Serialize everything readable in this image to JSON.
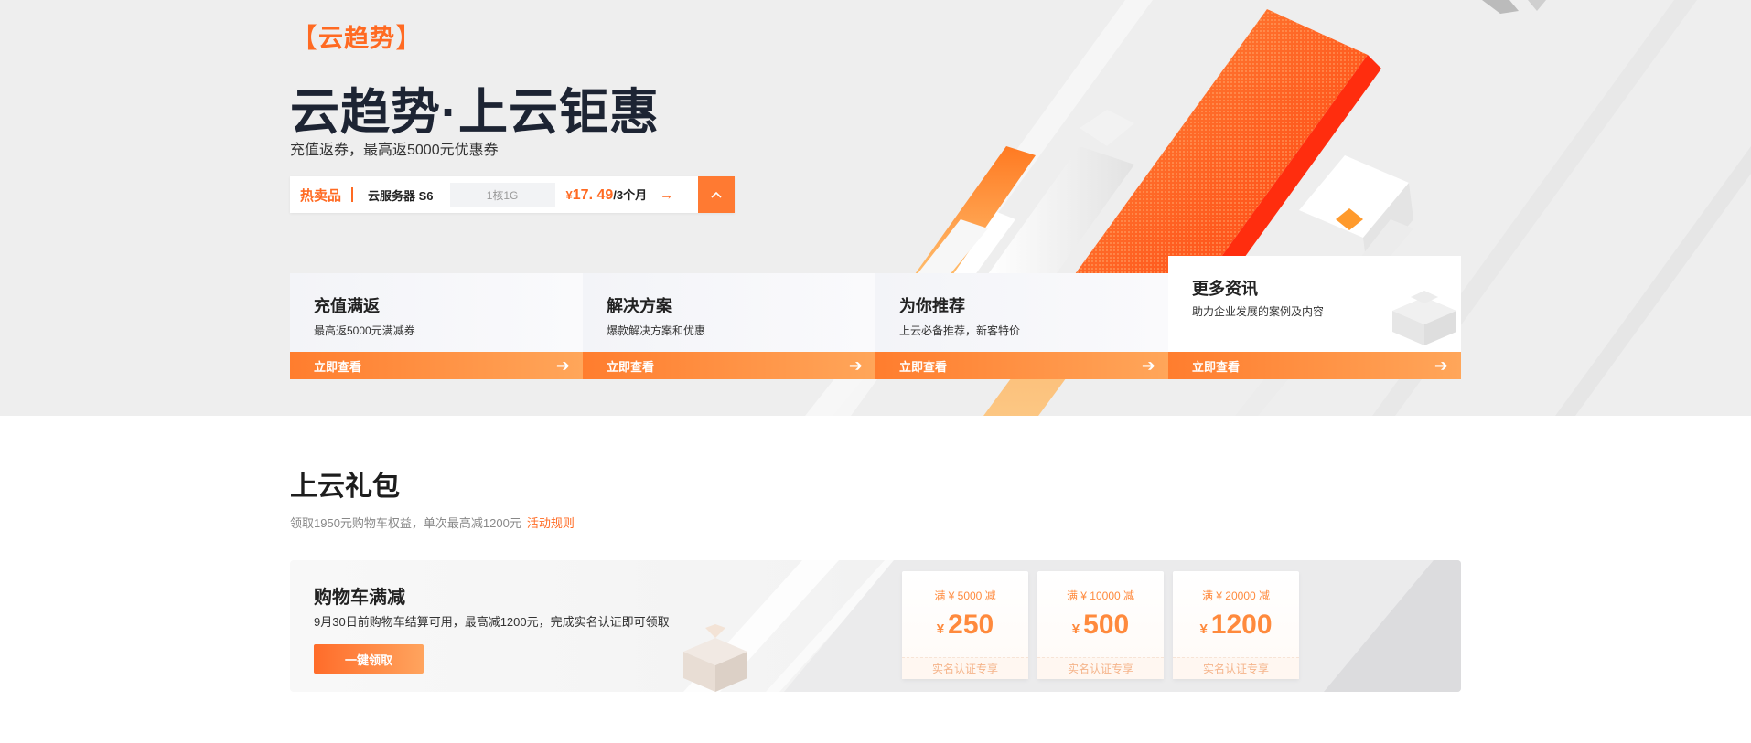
{
  "hero": {
    "brand_tag": "云趋势",
    "title": "云趋势·上云钜惠",
    "subtitle": "充值返券，最高返5000元优惠券",
    "hot": {
      "label": "热卖品",
      "product": "云服务器 S6",
      "spec": "1核1G",
      "price_symbol": "¥",
      "price": "17. 49",
      "price_unit": "/3个月"
    },
    "cards": [
      {
        "title": "充值满返",
        "desc": "最高返5000元满减券",
        "button": "立即查看"
      },
      {
        "title": "解决方案",
        "desc": "爆款解决方案和优惠",
        "button": "立即查看"
      },
      {
        "title": "为你推荐",
        "desc": "上云必备推荐，新客特价",
        "button": "立即查看"
      },
      {
        "title": "更多资讯",
        "desc": "助力企业发展的案例及内容",
        "button": "立即查看"
      }
    ]
  },
  "gift": {
    "title": "上云礼包",
    "subtitle": "领取1950元购物车权益，单次最高减1200元",
    "rule_link": "活动规则",
    "panel": {
      "title": "购物车满减",
      "desc": "9月30日前购物车结算可用，最高减1200元，完成实名认证即可领取",
      "button": "一键领取"
    },
    "coupons": [
      {
        "condition": "满 ¥ 5000 减",
        "yen": "¥",
        "amount": "250",
        "footer": "实名认证专享"
      },
      {
        "condition": "满 ¥ 10000 减",
        "yen": "¥",
        "amount": "500",
        "footer": "实名认证专享"
      },
      {
        "condition": "满 ¥ 20000 减",
        "yen": "¥",
        "amount": "1200",
        "footer": "实名认证专享"
      }
    ]
  },
  "colors": {
    "accent": "#ff6a22",
    "accent_light": "#ffa65a",
    "hero_bg": "#eeeeee",
    "title_dark": "#1d2433"
  },
  "icons": {
    "hot_arrow": "arrow-right-icon",
    "toggle": "chevron-up-icon",
    "card_arrow": "arrow-right-icon"
  }
}
